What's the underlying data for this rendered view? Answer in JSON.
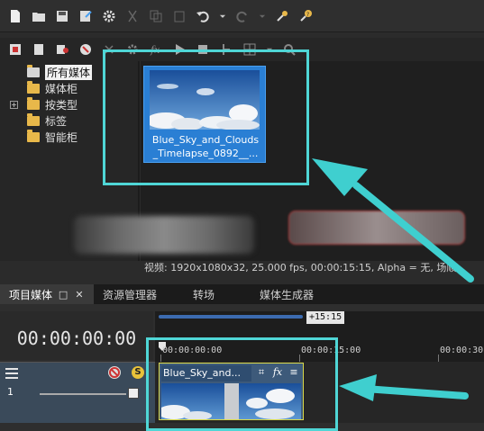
{
  "media_tree": {
    "items": [
      {
        "label": "所有媒体",
        "selected": true
      },
      {
        "label": "媒体柜"
      },
      {
        "label": "按类型",
        "expandable": true
      },
      {
        "label": "标签"
      },
      {
        "label": "智能柜"
      }
    ]
  },
  "media_item": {
    "name_line1": "Blue_Sky_and_Clouds",
    "name_line2": "_Timelapse_0892__..."
  },
  "info_bar": {
    "text": "视频: 1920x1080x32, 25.000 fps, 00:00:15:15, Alpha = 无, 场顺"
  },
  "tabs": [
    {
      "label": "项目媒体",
      "active": true
    },
    {
      "label": "资源管理器"
    },
    {
      "label": "转场"
    },
    {
      "label": "媒体生成器"
    }
  ],
  "tab_controls": {
    "dock": "□",
    "close": "✕"
  },
  "timeline": {
    "timecode": "00:00:00:00",
    "duration_label": "+15:15",
    "ruler_ticks": [
      "00:00:00:00",
      "00:00:15:00",
      "00:00:30"
    ]
  },
  "track": {
    "number": "1"
  },
  "clip": {
    "title": "Blue_Sky_and..."
  },
  "colors": {
    "highlight": "#4fd6d6",
    "accent": "#2a7fd4",
    "clip_border": "#d9d94a"
  }
}
